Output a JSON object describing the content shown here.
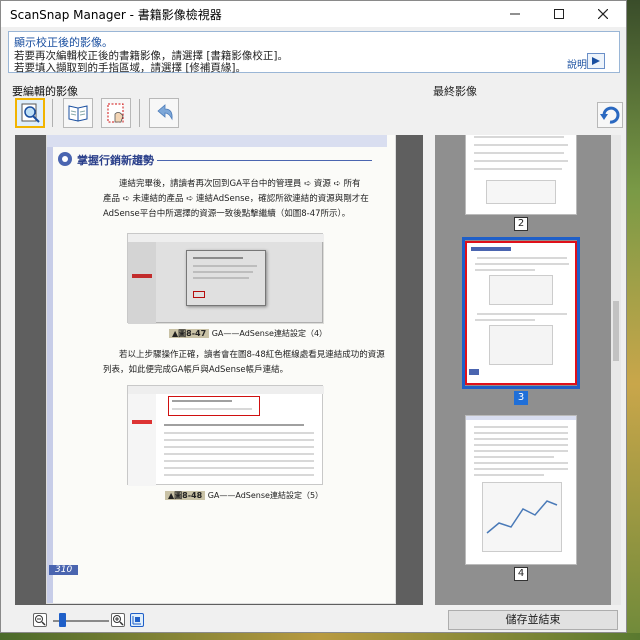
{
  "window": {
    "title": "ScanSnap Manager - 書籍影像檢視器"
  },
  "info": {
    "title": "顯示校正後的影像。",
    "line1": "若要再次編輯校正後的書籍影像，請選擇 [書籍影像校正]。",
    "line2": "若要填入擷取到的手指區域，請選擇 [修補頁緣]。",
    "help_label": "說明"
  },
  "left": {
    "label": "要編輯的影像"
  },
  "page": {
    "heading": "掌握行銷新趨勢",
    "para1_l1": "連結完畢後，請讀者再次回到GA平台中的管理員 ➪ 資源 ➪ 所有",
    "para1_l2": "產品 ➪ 未連結的產品 ➪ 連結AdSense，確認所欲連結的資源與剛才在",
    "para1_l3": "AdSense平台中所選擇的資源一致後點擊繼續（如圖8-47所示）。",
    "fig1_num": "▲圖8-47",
    "fig1_caption": "GA——AdSense連結設定（4）",
    "para2_l1": "若以上步驟操作正確，讀者會在圖8-48紅色框線處看見連結成功的資源",
    "para2_l2": "列表，如此便完成GA帳戶與AdSense帳戶連結。",
    "fig2_num": "▲圖8-48",
    "fig2_caption": "GA——AdSense連結設定（5）",
    "page_number": "310"
  },
  "right": {
    "label": "最終影像",
    "thumbs": [
      {
        "num": "2",
        "selected": false
      },
      {
        "num": "3",
        "selected": true
      },
      {
        "num": "4",
        "selected": false
      }
    ]
  },
  "footer": {
    "save_label": "儲存並結束"
  },
  "icons": {
    "tool1": "magnifier-page-icon",
    "tool2": "open-book-icon",
    "tool3": "finger-fill-icon",
    "tool4": "undo-icon",
    "rotate": "rotate-icon",
    "zoom_out": "zoom-out-icon",
    "zoom_in": "zoom-in-icon",
    "fit": "fit-page-icon"
  },
  "colors": {
    "accent": "#1f5fc8",
    "selected_border": "#e0101a",
    "active_tool": "#f2b400"
  }
}
